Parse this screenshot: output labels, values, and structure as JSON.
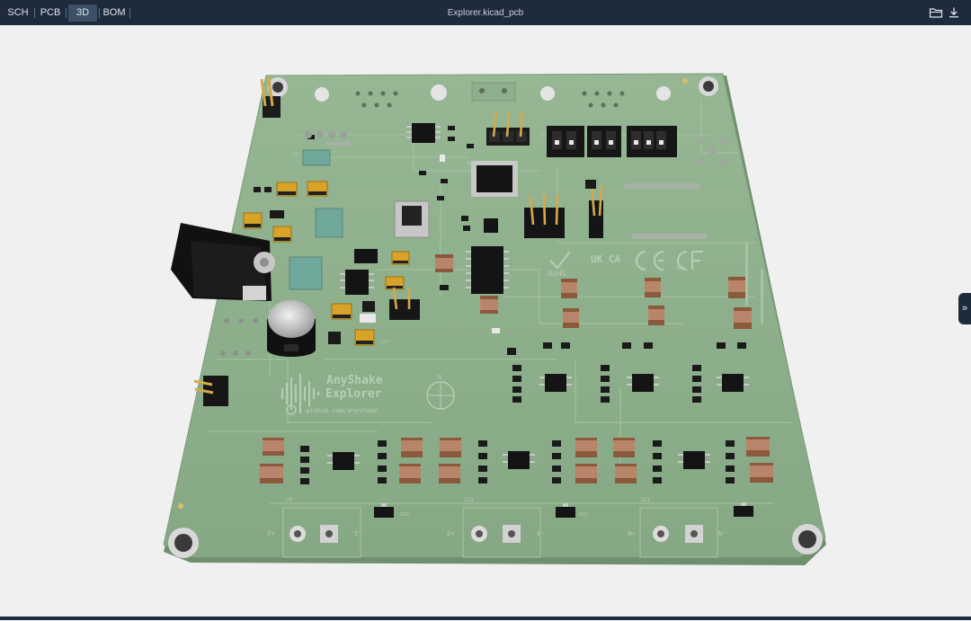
{
  "toolbar": {
    "tabs": [
      {
        "label": "SCH"
      },
      {
        "label": "PCB"
      },
      {
        "label": "3D"
      },
      {
        "label": "BOM"
      }
    ],
    "active_tab": "3D",
    "file_title": "Explorer.kicad_pcb",
    "open_icon": "folder-open-icon",
    "download_icon": "download-icon"
  },
  "viewer": {
    "expand_icon": "double-chevron-right-icon",
    "board": {
      "logo_line1": "AnyShake",
      "logo_line2": "Explorer",
      "url": "github.com/anyshake",
      "certs": [
        "RoHS",
        "UK CA",
        "CE",
        "FC"
      ],
      "connectors": [
        {
          "name": "J9",
          "pin_plus": "Z+",
          "pin_minus": "Z-"
        },
        {
          "name": "J12",
          "pin_plus": "E+",
          "pin_minus": "E-"
        },
        {
          "name": "J11",
          "pin_plus": "N+",
          "pin_minus": "N-"
        }
      ],
      "labels": {
        "north": "N",
        "c17": "C17",
        "d22": "D22",
        "d23": "D23",
        "r83": "R83",
        "r30": "R30",
        "c1": "C1"
      }
    }
  }
}
